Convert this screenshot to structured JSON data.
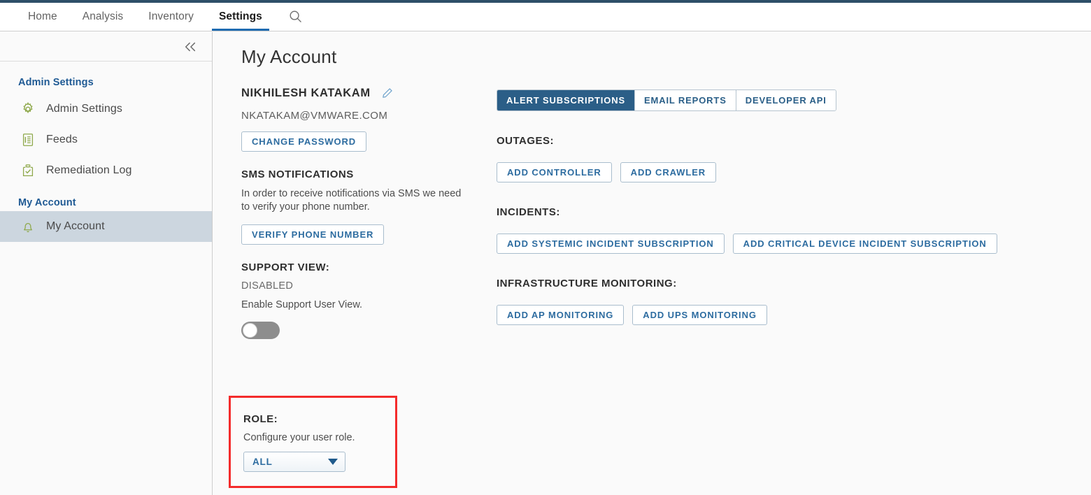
{
  "topnav": {
    "items": [
      {
        "label": "Home",
        "active": false
      },
      {
        "label": "Analysis",
        "active": false
      },
      {
        "label": "Inventory",
        "active": false
      },
      {
        "label": "Settings",
        "active": true
      }
    ],
    "search_icon": "search-icon"
  },
  "sidebar": {
    "collapse_icon": "double-chevron-left-icon",
    "groups": [
      {
        "label": "Admin Settings",
        "items": [
          {
            "label": "Admin Settings",
            "icon": "gear-icon",
            "selected": false
          },
          {
            "label": "Feeds",
            "icon": "list-document-icon",
            "selected": false
          },
          {
            "label": "Remediation Log",
            "icon": "clipboard-check-icon",
            "selected": false
          }
        ]
      },
      {
        "label": "My Account",
        "items": [
          {
            "label": "My Account",
            "icon": "bell-icon",
            "selected": true
          }
        ]
      }
    ]
  },
  "page": {
    "title": "My Account"
  },
  "account": {
    "name": "NIKHILESH KATAKAM",
    "edit_icon": "pencil-icon",
    "email": "NKATAKAM@VMWARE.COM",
    "change_password_label": "CHANGE PASSWORD",
    "sms": {
      "heading": "SMS NOTIFICATIONS",
      "description": "In order to receive notifications via SMS we need to verify your phone number.",
      "verify_label": "VERIFY PHONE NUMBER"
    },
    "support_view": {
      "heading": "SUPPORT VIEW:",
      "status": "DISABLED",
      "description": "Enable Support User View.",
      "toggle_state": "off"
    },
    "role": {
      "heading": "ROLE:",
      "description": "Configure your user role.",
      "selected": "ALL",
      "caret_icon": "caret-down-icon",
      "highlight_color": "#f42b2b"
    }
  },
  "subscriptions": {
    "tabs": [
      {
        "label": "ALERT SUBSCRIPTIONS",
        "active": true
      },
      {
        "label": "EMAIL REPORTS",
        "active": false
      },
      {
        "label": "DEVELOPER API",
        "active": false
      }
    ],
    "sections": [
      {
        "heading": "OUTAGES:",
        "buttons": [
          "ADD CONTROLLER",
          "ADD CRAWLER"
        ]
      },
      {
        "heading": "INCIDENTS:",
        "buttons": [
          "ADD SYSTEMIC INCIDENT SUBSCRIPTION",
          "ADD CRITICAL DEVICE INCIDENT SUBSCRIPTION"
        ]
      },
      {
        "heading": "INFRASTRUCTURE MONITORING:",
        "buttons": [
          "ADD AP MONITORING",
          "ADD UPS MONITORING"
        ]
      }
    ]
  },
  "colors": {
    "accent_blue": "#2b5e87",
    "link_blue": "#2d6ca0",
    "icon_green": "#8fa94c",
    "selected_row": "#ccd6df",
    "top_bar": "#2e4f68"
  }
}
